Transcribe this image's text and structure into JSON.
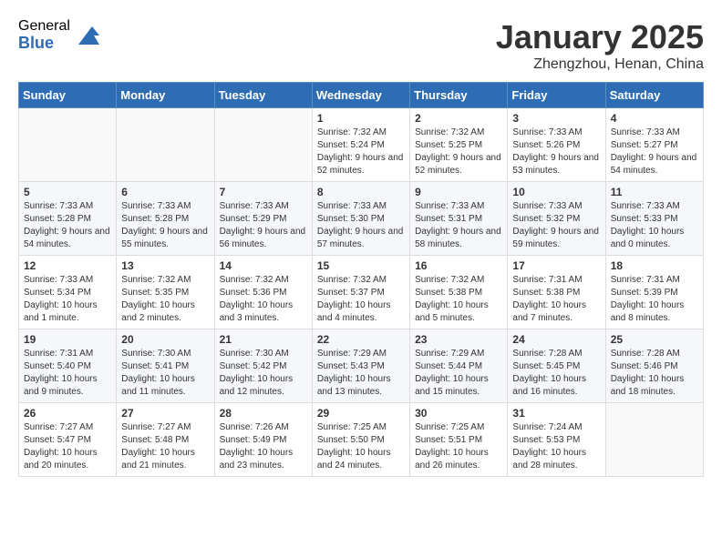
{
  "header": {
    "logo_general": "General",
    "logo_blue": "Blue",
    "month_title": "January 2025",
    "location": "Zhengzhou, Henan, China"
  },
  "weekdays": [
    "Sunday",
    "Monday",
    "Tuesday",
    "Wednesday",
    "Thursday",
    "Friday",
    "Saturday"
  ],
  "weeks": [
    [
      {
        "day": "",
        "sunrise": "",
        "sunset": "",
        "daylight": ""
      },
      {
        "day": "",
        "sunrise": "",
        "sunset": "",
        "daylight": ""
      },
      {
        "day": "",
        "sunrise": "",
        "sunset": "",
        "daylight": ""
      },
      {
        "day": "1",
        "sunrise": "Sunrise: 7:32 AM",
        "sunset": "Sunset: 5:24 PM",
        "daylight": "Daylight: 9 hours and 52 minutes."
      },
      {
        "day": "2",
        "sunrise": "Sunrise: 7:32 AM",
        "sunset": "Sunset: 5:25 PM",
        "daylight": "Daylight: 9 hours and 52 minutes."
      },
      {
        "day": "3",
        "sunrise": "Sunrise: 7:33 AM",
        "sunset": "Sunset: 5:26 PM",
        "daylight": "Daylight: 9 hours and 53 minutes."
      },
      {
        "day": "4",
        "sunrise": "Sunrise: 7:33 AM",
        "sunset": "Sunset: 5:27 PM",
        "daylight": "Daylight: 9 hours and 54 minutes."
      }
    ],
    [
      {
        "day": "5",
        "sunrise": "Sunrise: 7:33 AM",
        "sunset": "Sunset: 5:28 PM",
        "daylight": "Daylight: 9 hours and 54 minutes."
      },
      {
        "day": "6",
        "sunrise": "Sunrise: 7:33 AM",
        "sunset": "Sunset: 5:28 PM",
        "daylight": "Daylight: 9 hours and 55 minutes."
      },
      {
        "day": "7",
        "sunrise": "Sunrise: 7:33 AM",
        "sunset": "Sunset: 5:29 PM",
        "daylight": "Daylight: 9 hours and 56 minutes."
      },
      {
        "day": "8",
        "sunrise": "Sunrise: 7:33 AM",
        "sunset": "Sunset: 5:30 PM",
        "daylight": "Daylight: 9 hours and 57 minutes."
      },
      {
        "day": "9",
        "sunrise": "Sunrise: 7:33 AM",
        "sunset": "Sunset: 5:31 PM",
        "daylight": "Daylight: 9 hours and 58 minutes."
      },
      {
        "day": "10",
        "sunrise": "Sunrise: 7:33 AM",
        "sunset": "Sunset: 5:32 PM",
        "daylight": "Daylight: 9 hours and 59 minutes."
      },
      {
        "day": "11",
        "sunrise": "Sunrise: 7:33 AM",
        "sunset": "Sunset: 5:33 PM",
        "daylight": "Daylight: 10 hours and 0 minutes."
      }
    ],
    [
      {
        "day": "12",
        "sunrise": "Sunrise: 7:33 AM",
        "sunset": "Sunset: 5:34 PM",
        "daylight": "Daylight: 10 hours and 1 minute."
      },
      {
        "day": "13",
        "sunrise": "Sunrise: 7:32 AM",
        "sunset": "Sunset: 5:35 PM",
        "daylight": "Daylight: 10 hours and 2 minutes."
      },
      {
        "day": "14",
        "sunrise": "Sunrise: 7:32 AM",
        "sunset": "Sunset: 5:36 PM",
        "daylight": "Daylight: 10 hours and 3 minutes."
      },
      {
        "day": "15",
        "sunrise": "Sunrise: 7:32 AM",
        "sunset": "Sunset: 5:37 PM",
        "daylight": "Daylight: 10 hours and 4 minutes."
      },
      {
        "day": "16",
        "sunrise": "Sunrise: 7:32 AM",
        "sunset": "Sunset: 5:38 PM",
        "daylight": "Daylight: 10 hours and 5 minutes."
      },
      {
        "day": "17",
        "sunrise": "Sunrise: 7:31 AM",
        "sunset": "Sunset: 5:38 PM",
        "daylight": "Daylight: 10 hours and 7 minutes."
      },
      {
        "day": "18",
        "sunrise": "Sunrise: 7:31 AM",
        "sunset": "Sunset: 5:39 PM",
        "daylight": "Daylight: 10 hours and 8 minutes."
      }
    ],
    [
      {
        "day": "19",
        "sunrise": "Sunrise: 7:31 AM",
        "sunset": "Sunset: 5:40 PM",
        "daylight": "Daylight: 10 hours and 9 minutes."
      },
      {
        "day": "20",
        "sunrise": "Sunrise: 7:30 AM",
        "sunset": "Sunset: 5:41 PM",
        "daylight": "Daylight: 10 hours and 11 minutes."
      },
      {
        "day": "21",
        "sunrise": "Sunrise: 7:30 AM",
        "sunset": "Sunset: 5:42 PM",
        "daylight": "Daylight: 10 hours and 12 minutes."
      },
      {
        "day": "22",
        "sunrise": "Sunrise: 7:29 AM",
        "sunset": "Sunset: 5:43 PM",
        "daylight": "Daylight: 10 hours and 13 minutes."
      },
      {
        "day": "23",
        "sunrise": "Sunrise: 7:29 AM",
        "sunset": "Sunset: 5:44 PM",
        "daylight": "Daylight: 10 hours and 15 minutes."
      },
      {
        "day": "24",
        "sunrise": "Sunrise: 7:28 AM",
        "sunset": "Sunset: 5:45 PM",
        "daylight": "Daylight: 10 hours and 16 minutes."
      },
      {
        "day": "25",
        "sunrise": "Sunrise: 7:28 AM",
        "sunset": "Sunset: 5:46 PM",
        "daylight": "Daylight: 10 hours and 18 minutes."
      }
    ],
    [
      {
        "day": "26",
        "sunrise": "Sunrise: 7:27 AM",
        "sunset": "Sunset: 5:47 PM",
        "daylight": "Daylight: 10 hours and 20 minutes."
      },
      {
        "day": "27",
        "sunrise": "Sunrise: 7:27 AM",
        "sunset": "Sunset: 5:48 PM",
        "daylight": "Daylight: 10 hours and 21 minutes."
      },
      {
        "day": "28",
        "sunrise": "Sunrise: 7:26 AM",
        "sunset": "Sunset: 5:49 PM",
        "daylight": "Daylight: 10 hours and 23 minutes."
      },
      {
        "day": "29",
        "sunrise": "Sunrise: 7:25 AM",
        "sunset": "Sunset: 5:50 PM",
        "daylight": "Daylight: 10 hours and 24 minutes."
      },
      {
        "day": "30",
        "sunrise": "Sunrise: 7:25 AM",
        "sunset": "Sunset: 5:51 PM",
        "daylight": "Daylight: 10 hours and 26 minutes."
      },
      {
        "day": "31",
        "sunrise": "Sunrise: 7:24 AM",
        "sunset": "Sunset: 5:53 PM",
        "daylight": "Daylight: 10 hours and 28 minutes."
      },
      {
        "day": "",
        "sunrise": "",
        "sunset": "",
        "daylight": ""
      }
    ]
  ]
}
